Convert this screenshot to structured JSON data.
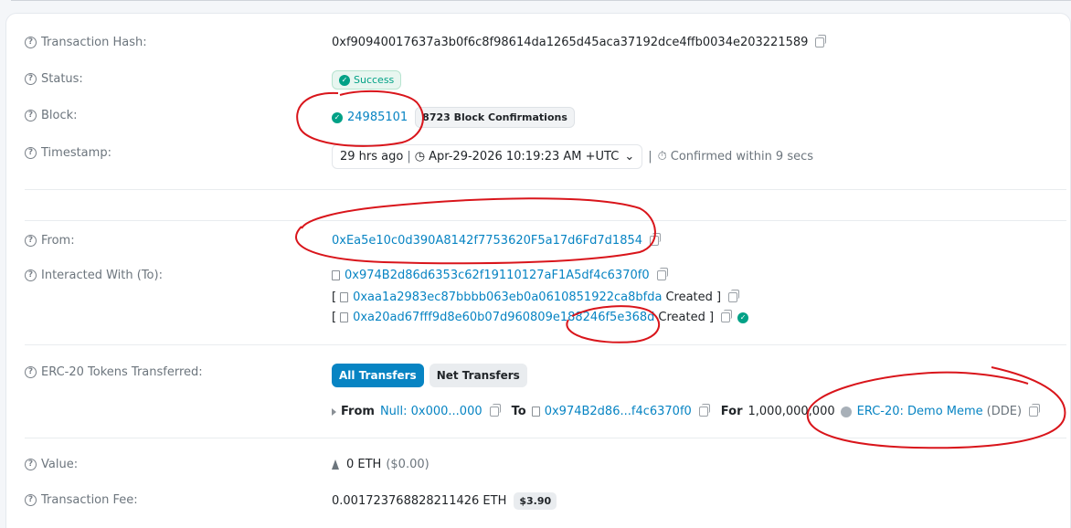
{
  "labels": {
    "tx_hash": "Transaction Hash:",
    "status": "Status:",
    "block": "Block:",
    "timestamp": "Timestamp:",
    "from": "From:",
    "interacted": "Interacted With (To):",
    "erc20": "ERC-20 Tokens Transferred:",
    "value": "Value:",
    "fee": "Transaction Fee:"
  },
  "tx": {
    "hash": "0xf90940017637a3b0f6c8f98614da1265d45aca37192dce4ffb0034e203221589",
    "status": "Success",
    "block_number": "24985101",
    "confirmations": "8723 Block Confirmations",
    "time_ago": "29 hrs ago",
    "time_full": "Apr-29-2026 10:19:23 AM +UTC",
    "confirmed_within": "Confirmed within 9 secs",
    "from": "0xEa5e10c0d390A8142f7753620F5a17d6Fd7d1854",
    "to_contract": "0x974B2d86d6353c62f19110127aF1A5df4c6370f0",
    "created_1": "0xaa1a2983ec87bbbb063eb0a0610851922ca8bfda",
    "created_2": "0xa20ad67fff9d8e60b07d960809e188246f5e368d",
    "created_label": "Created ]",
    "bracket_open": "[",
    "value_eth": "0 ETH",
    "value_usd": "($0.00)",
    "fee_eth": "0.001723768828211426 ETH",
    "fee_usd": "$3.90"
  },
  "transfers": {
    "tab_all": "All Transfers",
    "tab_net": "Net Transfers",
    "from_kw": "From",
    "from_addr": "Null: 0x000...000",
    "to_kw": "To",
    "to_addr": "0x974B2d86...f4c6370f0",
    "for_kw": "For",
    "amount": "1,000,000,000",
    "token_name": "ERC-20: Demo Meme",
    "token_symbol": "(DDE)"
  },
  "colors": {
    "link": "#0784c3",
    "success": "#00a186",
    "annotation": "#d9151b"
  },
  "icons": [
    "help-circle-icon",
    "copy-icon",
    "check-circle-icon",
    "clock-icon",
    "stopwatch-icon",
    "chevron-down-icon",
    "document-icon",
    "eth-icon",
    "triangle-right-icon",
    "token-icon"
  ]
}
